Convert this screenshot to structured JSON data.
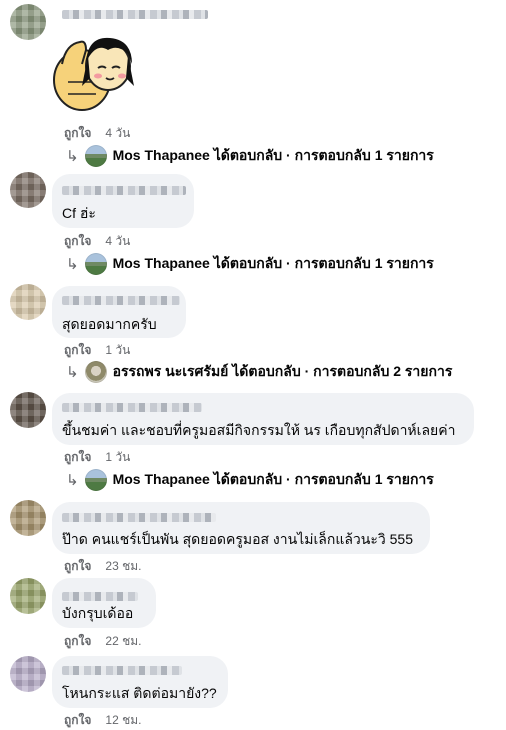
{
  "comments": [
    {
      "avatar_colors": [
        "#7a8a6e",
        "#b2bda4"
      ],
      "text": "",
      "likes_label": "ถูกใจ",
      "time": "4 วัน",
      "sticker": "thumbs-up-girl-sticker",
      "reply": {
        "text": "Mos Thapanee ได้ตอบกลับ · การตอบกลับ 1 รายการ"
      }
    },
    {
      "avatar_colors": [
        "#5c5148",
        "#b7a99a"
      ],
      "text": "Cf ฮ่ะ",
      "likes_label": "ถูกใจ",
      "time": "4 วัน",
      "reply": {
        "text": "Mos Thapanee ได้ตอบกลับ · การตอบกลับ 1 รายการ"
      }
    },
    {
      "avatar_colors": [
        "#c9b79a",
        "#efe6d6"
      ],
      "text": "สุดยอดมากครับ",
      "likes_label": "ถูกใจ",
      "time": "1 วัน",
      "reply": {
        "text": "อรรถพร นะเรศรัมย์ ได้ตอบกลับ · การตอบกลับ 2 รายการ"
      }
    },
    {
      "avatar_colors": [
        "#4a4036",
        "#8a7d6f"
      ],
      "text": "ขึ้นชมค่า และชอบที่ครูมอสมีกิจกรรมให้ นร เกือบทุกสัปดาห์เลยค่า",
      "likes_label": "ถูกใจ",
      "time": "1 วัน",
      "reply": {
        "text": "Mos Thapanee ได้ตอบกลับ · การตอบกลับ 1 รายการ"
      }
    },
    {
      "avatar_colors": [
        "#8c7a5c",
        "#d4c39e"
      ],
      "text": "ป๊าด คนแชร์เป็นพัน สุดยอดครูมอส งานไม่เล็กแล้วนะวิ 555",
      "likes_label": "ถูกใจ",
      "time": "23 ชม."
    },
    {
      "avatar_colors": [
        "#7b8a4e",
        "#c7cf9d"
      ],
      "text": "บังกรุบเด้ออ",
      "likes_label": "ถูกใจ",
      "time": "22 ชม."
    },
    {
      "avatar_colors": [
        "#9a8fb0",
        "#d8d0e4"
      ],
      "text": "โหนกระแส ติดต่อมายัง??",
      "likes_label": "ถูกใจ",
      "time": "12 ชม."
    }
  ]
}
